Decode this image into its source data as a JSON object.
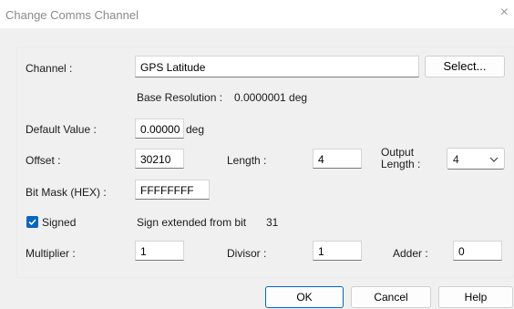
{
  "window": {
    "title": "Change Comms Channel",
    "close_glyph": "×"
  },
  "channel": {
    "label": "Channel :",
    "value": "GPS Latitude",
    "select_label": "Select..."
  },
  "base_resolution": {
    "label": "Base Resolution :",
    "value": "0.0000001 deg"
  },
  "default_value": {
    "label": "Default Value :",
    "value": "0.00000",
    "unit": "deg"
  },
  "offset": {
    "label": "Offset :",
    "value": "30210"
  },
  "length": {
    "label": "Length :",
    "value": "4"
  },
  "output_length": {
    "label_line1": "Output",
    "label_line2": "Length :",
    "value": "4"
  },
  "bit_mask": {
    "label": "Bit Mask (HEX) :",
    "value": "FFFFFFFF"
  },
  "signed": {
    "label": "Signed",
    "checked": true
  },
  "sign_extended": {
    "label": "Sign extended from bit",
    "value": "31"
  },
  "multiplier": {
    "label": "Multiplier :",
    "value": "1"
  },
  "divisor": {
    "label": "Divisor :",
    "value": "1"
  },
  "adder": {
    "label": "Adder :",
    "value": "0"
  },
  "buttons": {
    "ok": "OK",
    "cancel": "Cancel",
    "help": "Help"
  },
  "colors": {
    "accent": "#0067c0",
    "dialog_bg": "#f0f0f0",
    "title_text": "#8a8a8a"
  },
  "icons": {
    "close": "close-icon",
    "dropdown": "chevron-down-icon",
    "checkbox": "checkmark-icon"
  }
}
